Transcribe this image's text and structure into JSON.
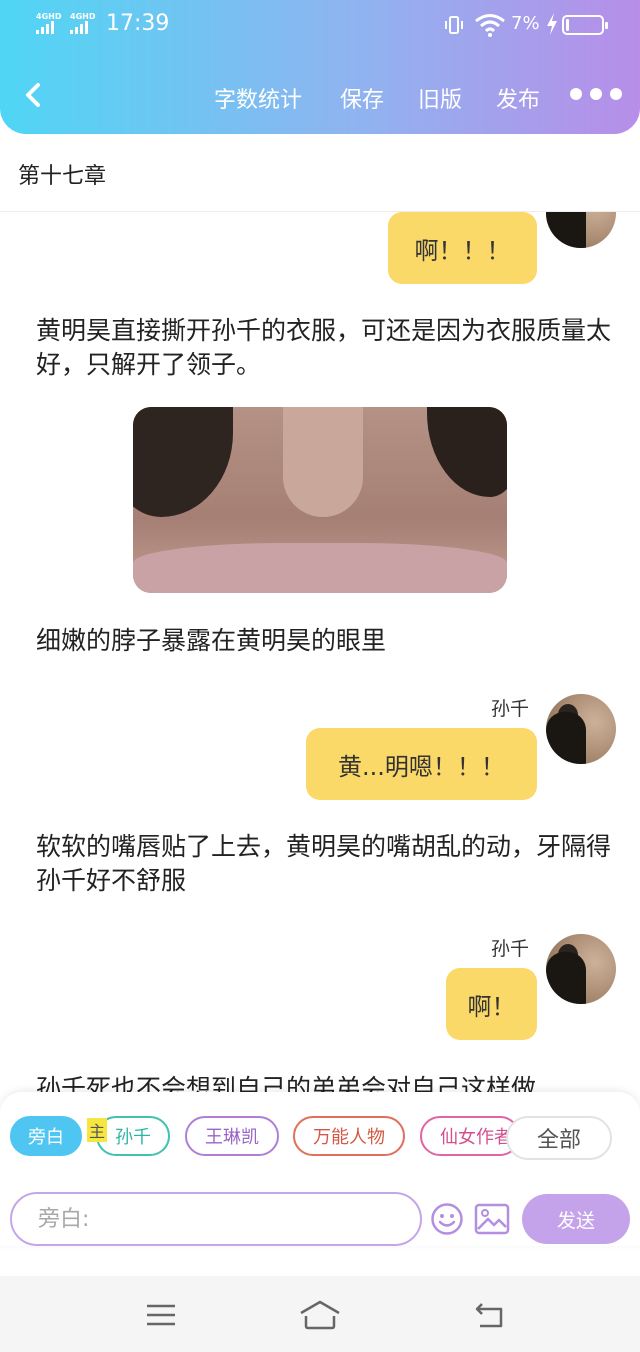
{
  "status_bar": {
    "network_1": "4GHD",
    "network_2": "4GHD",
    "time": "17:39",
    "battery_percent": "7%",
    "battery_level": 0.07
  },
  "nav": {
    "word_count": "字数统计",
    "save": "保存",
    "old_version": "旧版",
    "publish": "发布"
  },
  "chapter": {
    "title": "第十七章"
  },
  "messages": [
    {
      "bubble": "啊！！！"
    },
    {
      "speaker": "孙千",
      "bubble": "黄...明嗯！！！"
    },
    {
      "speaker": "孙千",
      "bubble": "啊！"
    }
  ],
  "paragraphs": [
    "黄明昊直接撕开孙千的衣服，可还是因为衣服质量太好，只解开了领子。",
    "细嫩的脖子暴露在黄明昊的眼里",
    "软软的嘴唇贴了上去，黄明昊的嘴胡乱的动，牙隔得孙千好不舒服",
    "孙千死也不会想到自己的弟弟会对自己这样做"
  ],
  "editor": {
    "roles": [
      "旁白",
      "孙千",
      "王琳凯",
      "万能人物",
      "仙女作者"
    ],
    "owner_badge": "主",
    "all": "全部",
    "input_placeholder": "旁白:",
    "send": "发送"
  },
  "colors": {
    "header_start": "#4fd6f4",
    "header_end": "#b78ee8",
    "bubble": "#fad969",
    "active_chip": "#4fc6f2",
    "send_button": "#c5a3ea"
  }
}
